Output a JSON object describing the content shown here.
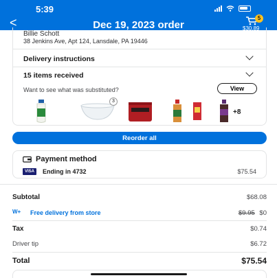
{
  "status_bar": {
    "time": "5:39"
  },
  "header": {
    "back": "<",
    "title": "Dec 19, 2023 order",
    "cart_count": "5",
    "cart_total": "$30.89"
  },
  "delivery": {
    "name": "Billie Schott",
    "address": "38 Jenkins Ave, Apt 124, Lansdale, PA 19446",
    "instructions_label": "Delivery instructions",
    "items_label": "15 items received",
    "substitute_question": "Want to see what was substituted?",
    "view_label": "View",
    "bowl_qty": "3",
    "more_count": "+8"
  },
  "reorder_label": "Reorder all",
  "payment": {
    "title": "Payment method",
    "card_brand": "VISA",
    "ending": "Ending in 4732",
    "amount": "$75.54"
  },
  "summary": {
    "subtotal_label": "Subtotal",
    "subtotal_value": "$68.08",
    "free_delivery_label": "Free delivery from store",
    "wplus_label": "W+",
    "delivery_original": "$9.95",
    "delivery_value": "$0",
    "tax_label": "Tax",
    "tax_value": "$0.74",
    "tip_label": "Driver tip",
    "tip_value": "$6.72",
    "total_label": "Total",
    "total_value": "$75.54"
  },
  "colors": {
    "primary": "#0071dc",
    "badge": "#ffc220"
  }
}
